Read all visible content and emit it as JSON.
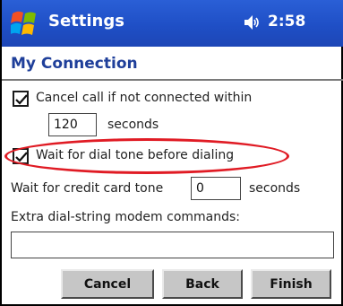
{
  "titlebar": {
    "title": "Settings",
    "time": "2:58",
    "logo_icon": "windows-logo-icon",
    "sound_icon": "speaker-icon"
  },
  "section": {
    "title": "My Connection"
  },
  "cancel_call": {
    "checked": true,
    "label": "Cancel call if not connected within"
  },
  "seconds_input": {
    "value": "120",
    "unit": "seconds"
  },
  "dial_tone": {
    "checked": true,
    "label": "Wait for dial tone before dialing"
  },
  "credit_card": {
    "label": "Wait for credit card tone",
    "value": "0",
    "unit": "seconds"
  },
  "modem": {
    "label": "Extra dial-string modem commands:",
    "value": ""
  },
  "buttons": {
    "cancel": "Cancel",
    "back": "Back",
    "finish": "Finish"
  },
  "colors": {
    "titlebar": "#1f4fc6",
    "section_title": "#1f3f9a",
    "highlight": "#e01b24"
  }
}
